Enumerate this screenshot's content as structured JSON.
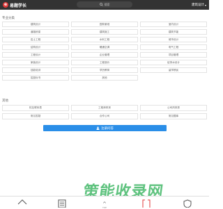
{
  "header": {
    "logo_mark": "e",
    "logo_text": "易题学长",
    "search_placeholder": "搜索",
    "site_switch": "建筑设计"
  },
  "categories": {
    "title": "专业分类",
    "items": [
      "建筑设计",
      "园林景观",
      "室内设计",
      "道路桥梁",
      "建筑施工",
      "建筑节能",
      "岩土工程",
      "水利工程",
      "城市设计",
      "结构设计",
      "暖通空调",
      "电气工程",
      "工程设计",
      "企业管理",
      "项目管理",
      "家装设计",
      "工程造价",
      "给排水设计",
      "技能培训",
      "学历教育",
      "留学移民",
      "招投标书",
      "其他"
    ]
  },
  "general": {
    "title": "其他",
    "items": [
      "校友联系表",
      "工程师风采",
      "公司风采秀",
      "常见答疑",
      "合作公司",
      "常见题库"
    ]
  },
  "register_button": "注册问答",
  "watermark": "策能收录网",
  "bottom_nav": {
    "items": [
      {
        "icon": "home-icon",
        "label": ""
      },
      {
        "icon": "document-icon",
        "label": ""
      },
      {
        "icon": "top-icon",
        "label": "TOP"
      },
      {
        "icon": "bracket-icon",
        "label": ""
      },
      {
        "icon": "shield-icon",
        "label": ""
      }
    ]
  }
}
